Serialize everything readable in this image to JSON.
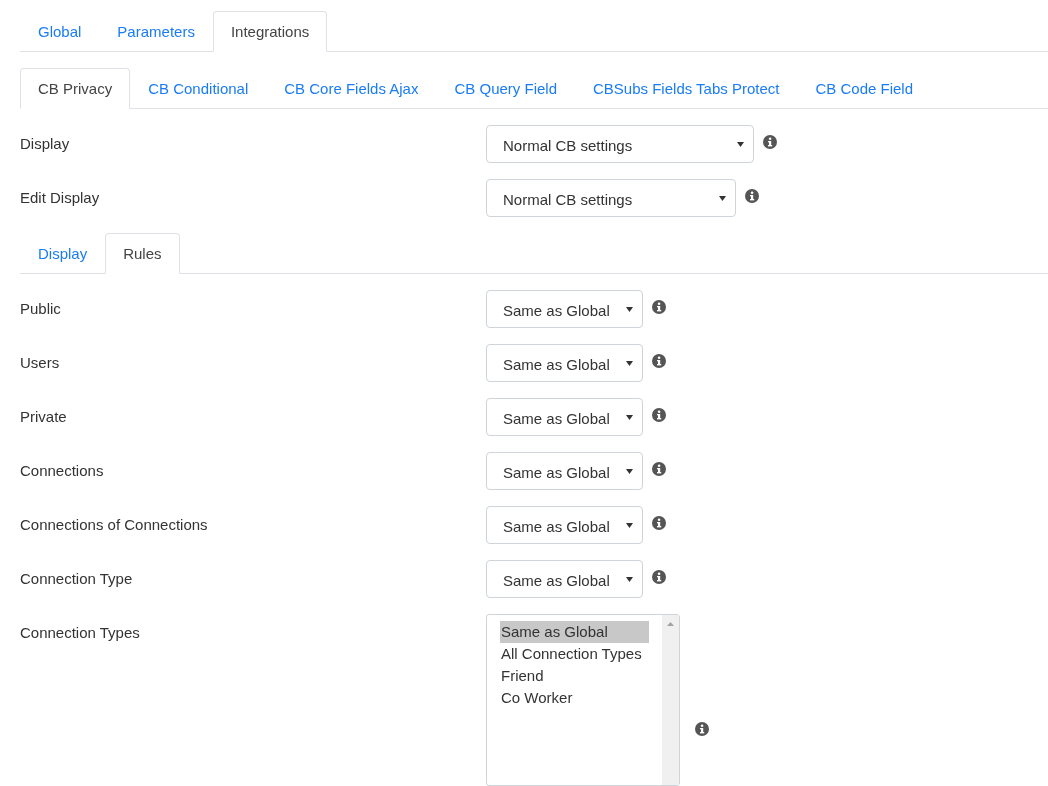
{
  "top_tabs": [
    {
      "label": "Global",
      "selected": false
    },
    {
      "label": "Parameters",
      "selected": false
    },
    {
      "label": "Integrations",
      "selected": true
    }
  ],
  "sub_tabs": [
    {
      "label": "CB Privacy",
      "selected": true
    },
    {
      "label": "CB Conditional",
      "selected": false
    },
    {
      "label": "CB Core Fields Ajax",
      "selected": false
    },
    {
      "label": "CB Query Field",
      "selected": false
    },
    {
      "label": "CBSubs Fields Tabs Protect",
      "selected": false
    },
    {
      "label": "CB Code Field",
      "selected": false
    }
  ],
  "display_fields": [
    {
      "label": "Display",
      "kind": "select",
      "value": "Normal CB settings"
    },
    {
      "label": "Edit Display",
      "kind": "select",
      "value": "Normal CB settings"
    }
  ],
  "inner_tabs": [
    {
      "label": "Display",
      "selected": false
    },
    {
      "label": "Rules",
      "selected": true
    }
  ],
  "rules": [
    {
      "label": "Public",
      "kind": "select",
      "value": "Same as Global"
    },
    {
      "label": "Users",
      "kind": "select",
      "value": "Same as Global"
    },
    {
      "label": "Private",
      "kind": "select",
      "value": "Same as Global"
    },
    {
      "label": "Connections",
      "kind": "select",
      "value": "Same as Global"
    },
    {
      "label": "Connections of Connections",
      "kind": "select",
      "value": "Same as Global"
    },
    {
      "label": "Connection Type",
      "kind": "select",
      "value": "Same as Global"
    },
    {
      "label": "Connection Types",
      "kind": "listbox",
      "options": [
        {
          "label": "Same as Global",
          "selected": true
        },
        {
          "label": "All Connection Types",
          "selected": false
        },
        {
          "label": "Friend",
          "selected": false
        },
        {
          "label": "Co Worker",
          "selected": false
        }
      ]
    }
  ]
}
